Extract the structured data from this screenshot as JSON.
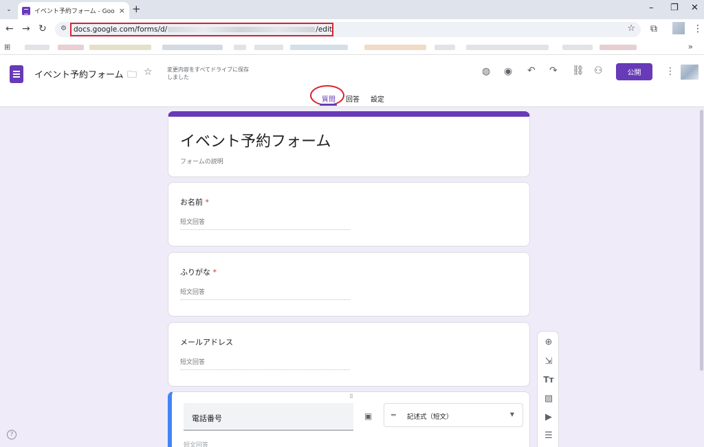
{
  "browser": {
    "tab_title": "イベント予約フォーム - Google フォ",
    "tab_close": "×",
    "new_tab": "+",
    "menu_chevron": "⌄",
    "url_prefix": "docs.google.com/forms/d/",
    "url_suffix": "/edit",
    "bookmarks_more": "»"
  },
  "header": {
    "doc_title": "イベント予約フォーム",
    "save_status": "変更内容をすべてドライブに保存しました",
    "publish_label": "公開",
    "icons": [
      "folder-icon",
      "star-icon",
      "palette-icon",
      "preview-icon",
      "undo-icon",
      "redo-icon",
      "link-icon",
      "add-collaborator-icon",
      "more-icon"
    ]
  },
  "tabs": {
    "questions": "質問",
    "responses": "回答",
    "settings": "設定"
  },
  "form": {
    "title": "イベント予約フォーム",
    "description_placeholder": "フォームの説明",
    "questions": [
      {
        "label": "お名前",
        "required": true,
        "answer_placeholder": "短文回答"
      },
      {
        "label": "ふりがな",
        "required": true,
        "answer_placeholder": "短文回答"
      },
      {
        "label": "メールアドレス",
        "required": false,
        "answer_placeholder": "短文回答"
      }
    ],
    "active_question": {
      "label": "電話番号",
      "type_label": "記述式（短文）",
      "answer_placeholder": "短文回答"
    }
  },
  "required_mark": "*",
  "side_toolbar": [
    "add-question-icon",
    "import-questions-icon",
    "add-title-icon",
    "add-image-icon",
    "add-video-icon",
    "add-section-icon"
  ],
  "colors": {
    "accent": "#673ab7",
    "active_border": "#4285f4",
    "annotation_red": "#d9232e",
    "background": "#f0ebf8"
  }
}
